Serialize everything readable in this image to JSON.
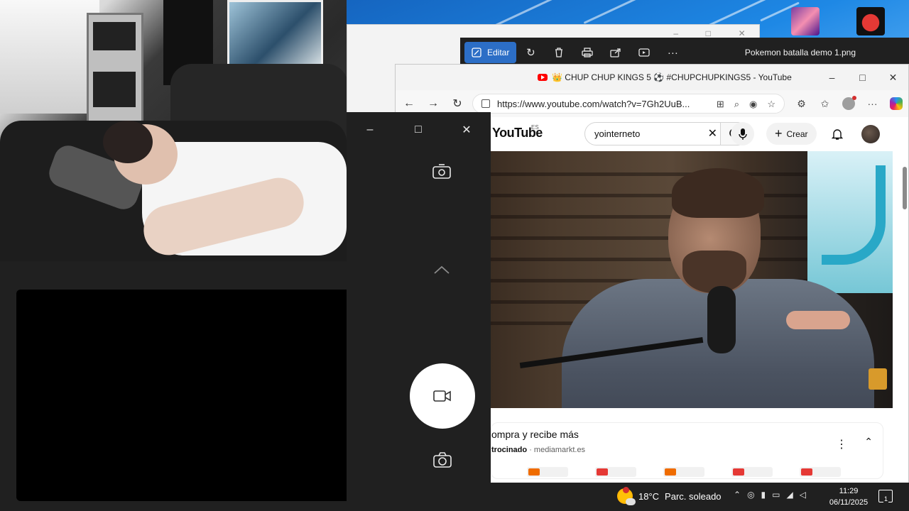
{
  "photos": {
    "edit_label": "Editar",
    "file_title": "Pokemon batalla demo 1.png"
  },
  "browser": {
    "tab_title": "👑 CHUP CHUP KINGS 5 ⚽ #CHUPCHUPKINGS5 - YouTube",
    "url": "https://www.youtube.com/watch?v=7Gh2UuB...",
    "minimize": "–",
    "maximize": "□",
    "close": "✕"
  },
  "youtube": {
    "logo_text": "YouTube",
    "country_code": "ES",
    "search_value": "yointerneto",
    "create_label": "Crear",
    "ad": {
      "title": "ompra y recibe más",
      "sponsor_label": "trocinado",
      "sponsor_domain": "mediamarkt.es"
    }
  },
  "taskbar": {
    "temperature": "18°C",
    "weather": "Parc. soleado",
    "time": "11:29",
    "date": "06/11/2025",
    "notification_count": "1"
  },
  "colors": {
    "accent": "#2c6ec6",
    "youtube_red": "#ff0000",
    "dark_panel": "#202020"
  }
}
